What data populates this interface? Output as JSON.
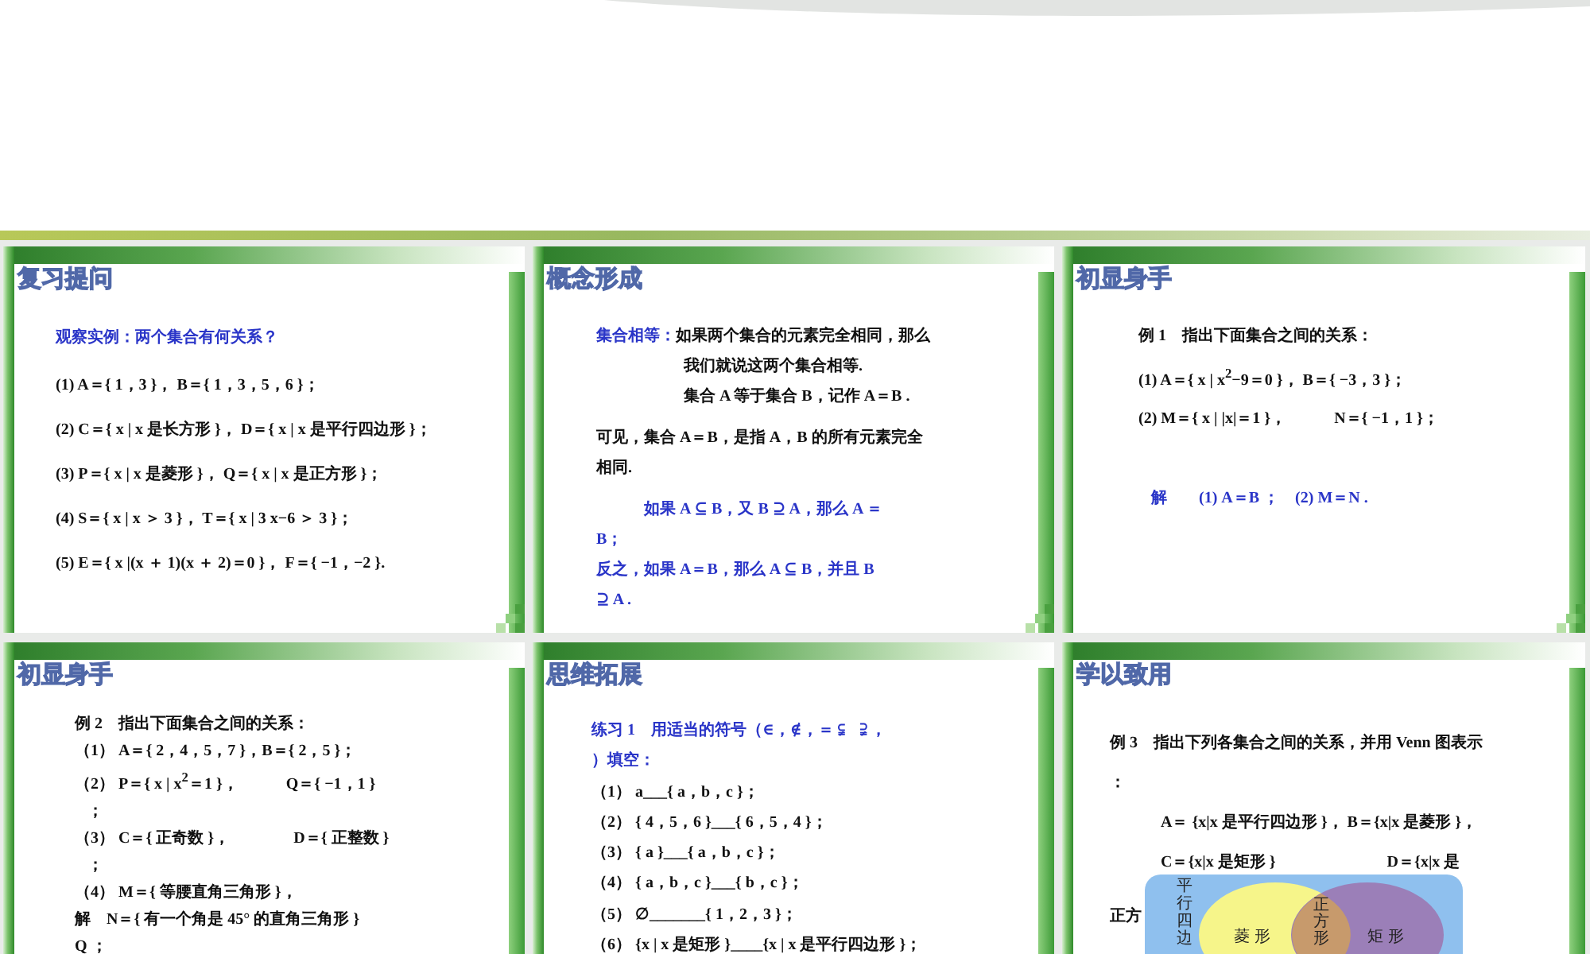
{
  "slides": [
    {
      "title": "复习提问",
      "lines": [
        {
          "text": "观察实例：两个集合有何关系？",
          "blue": true,
          "kind": "line"
        },
        {
          "text": "(1) A＝{ 1，3 }， B＝{ 1，3，5，6 }；",
          "blue": false,
          "kind": "line"
        },
        {
          "text": "(2) C＝{ x | x 是长方形 }， D＝{ x | x 是平行四边形 }；",
          "blue": false,
          "kind": "line"
        },
        {
          "text": "(3) P＝{ x | x 是菱形 }， Q＝{ x | x 是正方形 }；",
          "blue": false,
          "kind": "line"
        },
        {
          "text": "(4) S＝{ x | x ＞ 3 }， T＝{ x | 3 x−6 ＞ 3 }；",
          "blue": false,
          "kind": "line"
        },
        {
          "text": "(5) E＝{ x |(x ＋ 1)(x ＋ 2)＝0 }， F＝{ −1，−2 }.",
          "blue": false,
          "kind": "line"
        }
      ]
    },
    {
      "title": "概念形成",
      "lines": [
        {
          "term": "集合相等：",
          "text": "如果两个集合的元素完全相同，那么",
          "blue": false,
          "kind": "line"
        },
        {
          "text": "我们就说这两个集合相等.",
          "blue": false,
          "kind": "indented"
        },
        {
          "text": "集合 A 等于集合 B，记作 A＝B .",
          "blue": false,
          "kind": "indented"
        },
        {
          "text": "可见，集合 A＝B，是指 A，B 的所有元素完全",
          "blue": false,
          "kind": "para"
        },
        {
          "text": "相同.",
          "blue": false,
          "kind": "line"
        },
        {
          "text": "　　　如果 A ⊆ B，又 B ⊇ A，那么 A ＝",
          "blue": true,
          "kind": "para"
        },
        {
          "text": "B；",
          "blue": true,
          "kind": "line"
        },
        {
          "text": "反之，如果 A＝B，那么 A ⊆ B，并且 B",
          "blue": true,
          "kind": "line"
        },
        {
          "text": "⊇ A .",
          "blue": true,
          "kind": "line"
        }
      ]
    },
    {
      "title": "初显身手",
      "lines": [
        {
          "text": "例 1　指出下面集合之间的关系：",
          "blue": false,
          "kind": "line"
        },
        {
          "text": "(1) A＝{ x | x$^{2}$−9＝0 }， B＝{ −3，3 }；",
          "blue": false,
          "kind": "line"
        },
        {
          "text": "(2) M＝{ x | |x|＝1 }，　　　N＝{ −1，1 }；",
          "blue": false,
          "kind": "line"
        },
        {
          "text": "解　　(1) A＝B ；　(2) M＝N .",
          "blue": true,
          "kind": "para"
        }
      ]
    },
    {
      "title": "初显身手",
      "lines": [
        {
          "text": "例 2　指出下面集合之间的关系：",
          "blue": false,
          "kind": "line"
        },
        {
          "text": "（1） A＝{ 2，4，5，7 }，B＝{ 2，5 }；",
          "blue": false,
          "kind": "line"
        },
        {
          "text": "（2） P＝{ x | x$^{2}$＝1 }，　　　Q＝{ −1，1 }",
          "blue": false,
          "kind": "line"
        },
        {
          "text": "；",
          "blue": false,
          "kind": "indented"
        },
        {
          "text": "（3） C＝{ 正奇数 }，　　　　D＝{ 正整数 }",
          "blue": false,
          "kind": "line"
        },
        {
          "text": "；",
          "blue": false,
          "kind": "indented"
        },
        {
          "text": "（4） M＝{ 等腰直角三角形 }，",
          "blue": false,
          "kind": "line"
        },
        {
          "text": "解　N＝{ 有一个角是 45° 的直角三角形 }",
          "blue": false,
          "kind": "line"
        },
        {
          "text": "Q ；",
          "blue": false,
          "kind": "line"
        }
      ]
    },
    {
      "title": "思维拓展",
      "lines": [
        {
          "text": "练习 1　用适当的符号（∈，∉，＝ ⫋　⫌ ，",
          "blue": true,
          "kind": "line"
        },
        {
          "text": "）填空：",
          "blue": true,
          "kind": "line"
        },
        {
          "text": "（1） a___{ a，b，c }；",
          "blue": false,
          "kind": "line"
        },
        {
          "text": "（2） { 4，5，6 }___{ 6，5，4 }；",
          "blue": false,
          "kind": "line"
        },
        {
          "text": "（3） { a }___{ a，b，c }；",
          "blue": false,
          "kind": "line"
        },
        {
          "text": "（4） { a，b，c }___{ b，c }；",
          "blue": false,
          "kind": "line"
        },
        {
          "text": "（5） ∅_______{ 1，2，3 }；",
          "blue": false,
          "kind": "line"
        },
        {
          "text": "（6） {x | x 是矩形 }____{x | x 是平行四边形 }；",
          "blue": false,
          "kind": "line"
        }
      ]
    },
    {
      "title": "学以致用",
      "lines": [
        {
          "text": "例 3　指出下列各集合之间的关系，并用 Venn 图表示",
          "blue": false,
          "kind": "line"
        },
        {
          "text": "：",
          "blue": false,
          "kind": "line"
        },
        {
          "text": "A＝ {x|x 是平行四边形 }， B＝{x|x 是菱形 }，",
          "blue": false,
          "kind": "indented"
        },
        {
          "text": "C＝{x|x 是矩形 }　　　　　　　D＝{x|x 是",
          "blue": false,
          "kind": "indented"
        }
      ],
      "venn": {
        "lead": "正方",
        "outer_label": "平行四边",
        "left_label": "菱 形",
        "overlap_label": "正方形",
        "right_label": "矩 形"
      }
    }
  ]
}
